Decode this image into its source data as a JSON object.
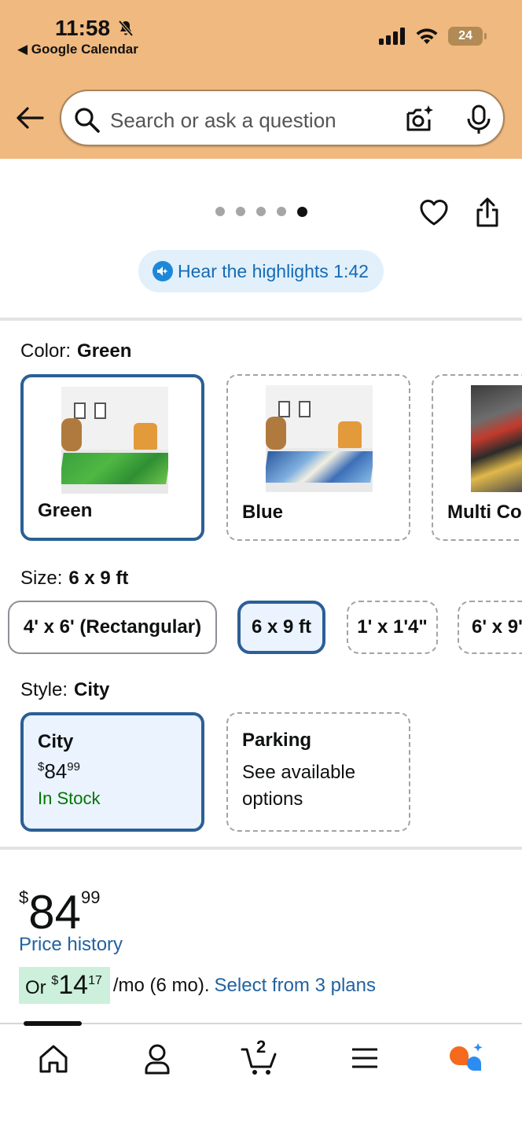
{
  "status_bar": {
    "time": "11:58",
    "back_app": "◀ Google Calendar",
    "battery": "24"
  },
  "search": {
    "placeholder": "Search or ask a question"
  },
  "carousel": {
    "dot_count": 5,
    "active_dot": 5
  },
  "highlights": {
    "label": "Hear the highlights 1:42"
  },
  "color": {
    "label": "Color:",
    "selected": "Green",
    "options": [
      "Green",
      "Blue",
      "Multi Co"
    ]
  },
  "size": {
    "label": "Size:",
    "selected": "6 x 9 ft",
    "options": [
      "4' x 6' (Rectangular)",
      "6 x 9 ft",
      "1' x 1'4\"",
      "6' x 9'"
    ]
  },
  "style": {
    "label": "Style:",
    "selected": "City",
    "options": [
      {
        "name": "City",
        "price_symbol": "$",
        "price_whole": "84",
        "price_cents": "99",
        "stock": "In Stock"
      },
      {
        "name": "Parking",
        "desc_line1": "See available",
        "desc_line2": "options"
      }
    ]
  },
  "price": {
    "symbol": "$",
    "whole": "84",
    "cents": "99",
    "history_link": "Price history"
  },
  "monthly": {
    "prefix": "Or ",
    "symbol": "$",
    "whole": "14",
    "cents": "17",
    "suffix": " /mo (6 mo).",
    "link": "Select from 3 plans"
  },
  "nav": {
    "cart_count": "2",
    "items": [
      "home-icon",
      "account-icon",
      "cart-icon",
      "menu-icon",
      "rufus-icon"
    ]
  },
  "colors": {
    "header_bg": "#f0b97f",
    "selected_border": "#2b5f95",
    "selected_bg": "#eaf3fe",
    "link": "#2162a1",
    "in_stock": "#007600"
  }
}
